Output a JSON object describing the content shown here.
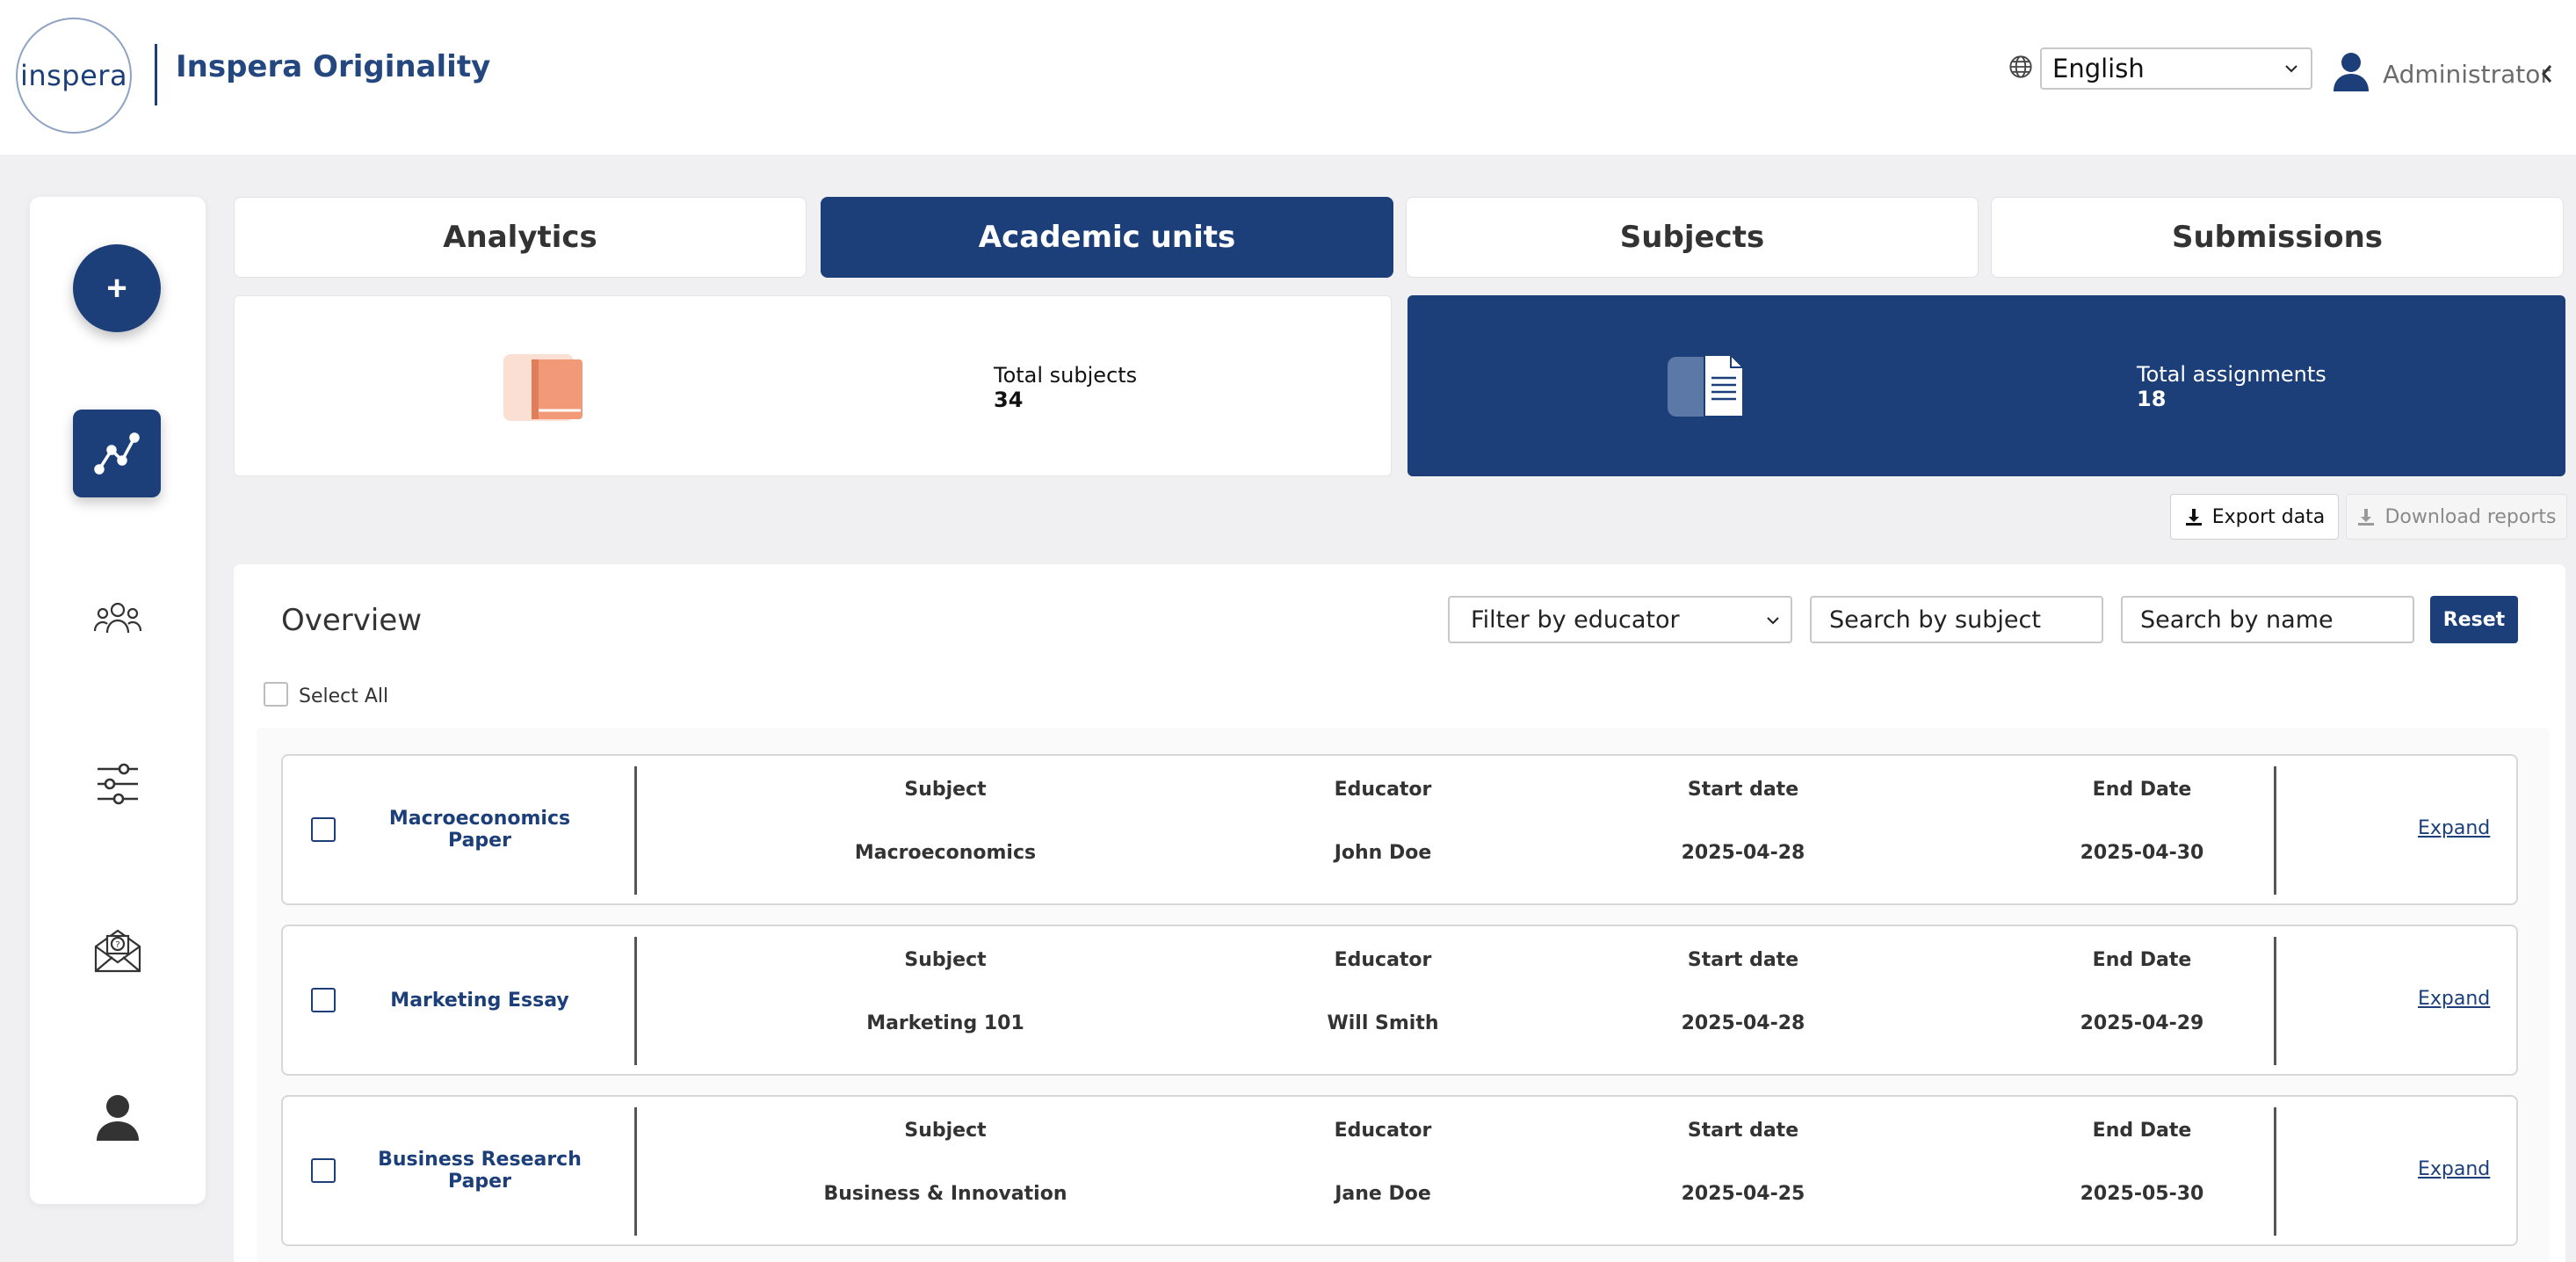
{
  "header": {
    "logo_text": "inspera",
    "brand_title": "Inspera Originality",
    "language": {
      "selected": "English"
    },
    "user": {
      "label": "Administrator"
    }
  },
  "sidebar": {
    "icons": [
      "add-icon",
      "analytics-chart-icon",
      "users-group-icon",
      "sliders-settings-icon",
      "mail-question-icon",
      "user-profile-icon"
    ],
    "add_symbol": "+"
  },
  "tabs": [
    {
      "label": "Analytics",
      "active": false
    },
    {
      "label": "Academic units",
      "active": true
    },
    {
      "label": "Subjects",
      "active": false
    },
    {
      "label": "Submissions",
      "active": false
    }
  ],
  "stats": {
    "subjects": {
      "label": "Total subjects",
      "value": "34",
      "icon": "book-icon"
    },
    "assignments": {
      "label": "Total assignments",
      "value": "18",
      "icon": "document-icon"
    }
  },
  "actions": {
    "export_label": "Export data",
    "download_label": "Download reports"
  },
  "overview": {
    "title": "Overview",
    "filter_educator": "Filter by educator",
    "search_subject_placeholder": "Search by subject",
    "search_name_placeholder": "Search by name",
    "reset_label": "Reset",
    "select_all_label": "Select All",
    "columns": {
      "subject": "Subject",
      "educator": "Educator",
      "start": "Start date",
      "end": "End Date"
    },
    "expand_label": "Expand",
    "rows": [
      {
        "name": "Macroeconomics Paper",
        "subject": "Macroeconomics",
        "educator": "John Doe",
        "start": "2025-04-28",
        "end": "2025-04-30"
      },
      {
        "name": "Marketing Essay",
        "subject": "Marketing 101",
        "educator": "Will Smith",
        "start": "2025-04-28",
        "end": "2025-04-29"
      },
      {
        "name": "Business Research Paper",
        "subject": "Business & Innovation",
        "educator": "Jane Doe",
        "start": "2025-04-25",
        "end": "2025-05-30"
      }
    ]
  },
  "colors": {
    "primary": "#1c3f7a",
    "book_icon": "#f29a78",
    "background": "#f0f0f2"
  }
}
